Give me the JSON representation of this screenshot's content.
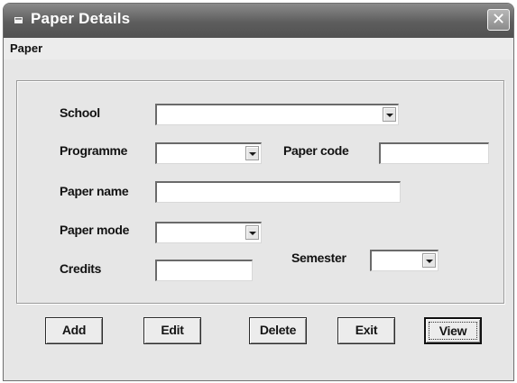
{
  "window": {
    "title": "Paper Details",
    "close_glyph": "✕"
  },
  "menu": {
    "items": [
      "Paper"
    ]
  },
  "form": {
    "school": {
      "label": "School",
      "value": ""
    },
    "programme": {
      "label": "Programme",
      "value": ""
    },
    "paper_code": {
      "label": "Paper code",
      "value": ""
    },
    "paper_name": {
      "label": "Paper name",
      "value": ""
    },
    "paper_mode": {
      "label": "Paper mode",
      "value": ""
    },
    "semester": {
      "label": "Semester",
      "value": ""
    },
    "credits": {
      "label": "Credits",
      "value": ""
    }
  },
  "buttons": {
    "add": "Add",
    "edit": "Edit",
    "delete": "Delete",
    "exit": "Exit",
    "view": "View"
  },
  "icons": {
    "title": "window-menu-icon",
    "close": "close-icon",
    "dropdown": "chevron-down-icon"
  },
  "colors": {
    "title_bar": "#5d5d5d",
    "window_bg": "#e6e6e6",
    "field_bg": "#ffffff"
  }
}
